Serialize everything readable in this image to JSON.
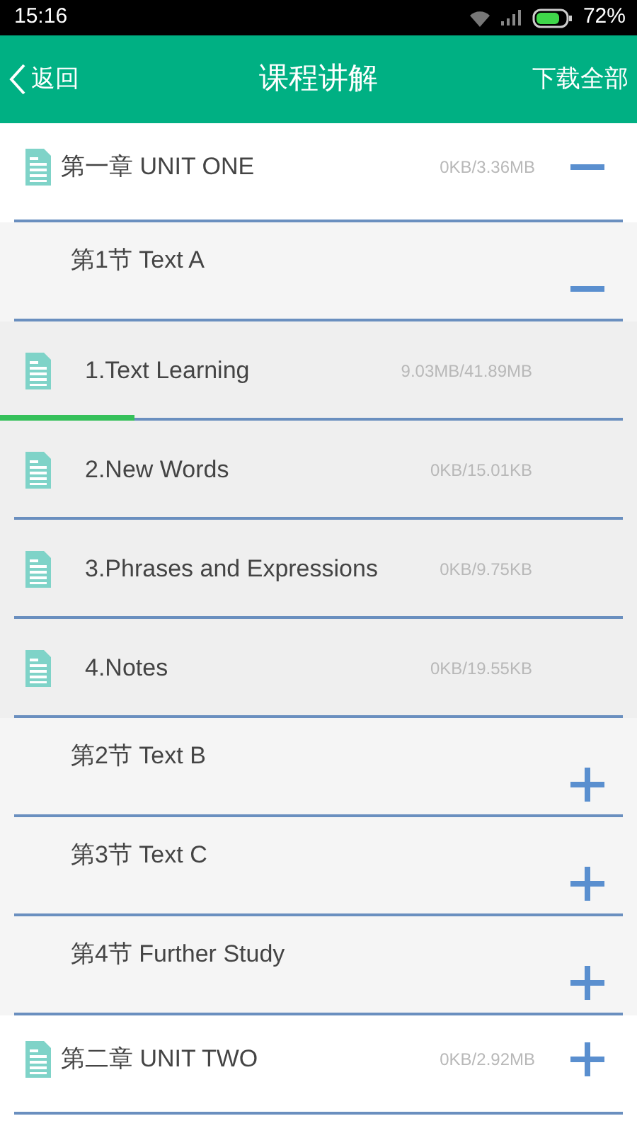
{
  "status_bar": {
    "time": "15:16",
    "battery": "72%"
  },
  "header": {
    "back": "返回",
    "title": "课程讲解",
    "action": "下载全部"
  },
  "chapters": [
    {
      "title": "第一章 UNIT ONE",
      "size": "0KB/3.36MB",
      "expanded": true,
      "sections": [
        {
          "title": "第1节 Text A",
          "expanded": true,
          "lessons": [
            {
              "title": "1.Text Learning",
              "size": "9.03MB/41.89MB",
              "level": 0.216
            },
            {
              "title": "2.New Words",
              "size": "0KB/15.01KB"
            },
            {
              "title": "3.Phrases and Expressions",
              "size": "0KB/9.75KB"
            },
            {
              "title": "4.Notes",
              "size": "0KB/19.55KB"
            }
          ]
        },
        {
          "title": "第2节 Text B",
          "expanded": false
        },
        {
          "title": "第3节 Text C",
          "expanded": false
        },
        {
          "title": "第4节 Further Study",
          "expanded": false
        }
      ]
    },
    {
      "title": "第二章 UNIT TWO",
      "size": "0KB/2.92MB",
      "expanded": false
    }
  ]
}
